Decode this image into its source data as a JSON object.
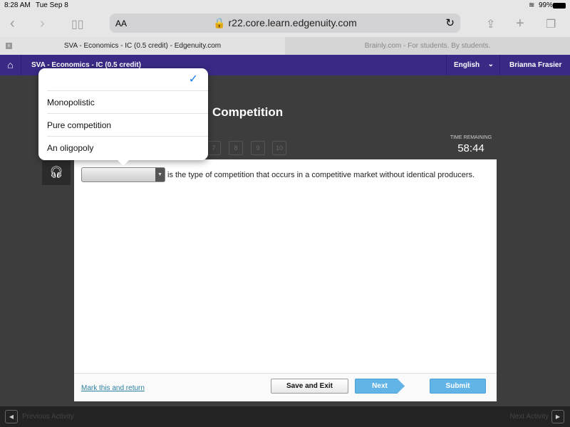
{
  "status": {
    "time": "8:28 AM",
    "date": "Tue Sep 8",
    "battery": "99%"
  },
  "browser": {
    "text_size": "AA",
    "url": "r22.core.learn.edgenuity.com",
    "tabs": [
      {
        "label": "SVA - Economics - IC (0.5 credit) - Edgenuity.com",
        "active": true
      },
      {
        "label": "Brainly.com - For students. By students.",
        "active": false
      }
    ]
  },
  "nav": {
    "course": "SVA - Economics - IC (0.5 credit)",
    "language": "English",
    "user": "Brianna Frasier",
    "color": "#3a2a86"
  },
  "page": {
    "title_visible": "Competition",
    "question_numbers": [
      "7",
      "8",
      "9",
      "10"
    ],
    "time_label": "TIME REMAINING",
    "time_value": "58:44"
  },
  "question": {
    "selected": "",
    "text": "is the type of competition that occurs in a competitive market without identical producers."
  },
  "dropdown": {
    "options": [
      "",
      "Monopolistic",
      "Pure competition",
      "An oligopoly"
    ],
    "checked_index": 0
  },
  "footer": {
    "mark": "Mark this and return",
    "save": "Save and Exit",
    "next": "Next",
    "submit": "Submit"
  },
  "bottom": {
    "prev": "Previous Activity",
    "next": "Next Activity"
  }
}
